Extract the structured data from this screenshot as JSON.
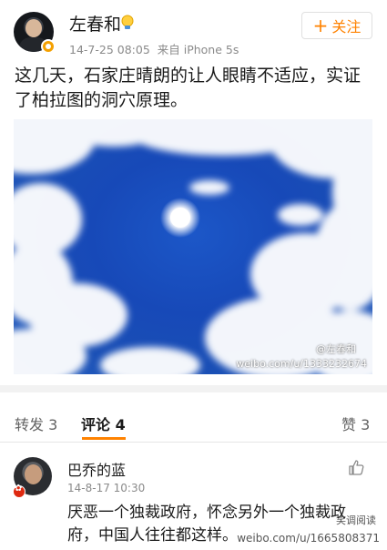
{
  "post": {
    "author": "左春和",
    "date": "14-7-25 08:05",
    "source": "来自 iPhone 5s",
    "follow_label": "关注",
    "text": "这几天，石家庄晴朗的让人眼睛不适应，实证了柏拉图的洞穴原理。",
    "photo_watermark_handle": "@左春和",
    "photo_watermark_url": "weibo.com/u/1333232674"
  },
  "tabs": {
    "repost": "转发 3",
    "comment": "评论 4",
    "like": "赞 3"
  },
  "comment": {
    "name": "巴乔的蓝",
    "time": "14-8-17 10:30",
    "text": "厌恶一个独裁政府，怀念另外一个独裁政府，中国人往往都这样。"
  },
  "page_watermark": {
    "account": "笑调阅读",
    "url": "weibo.com/u/1665808371"
  },
  "colors": {
    "accent": "#ff8200",
    "sky": "#1a4fb5"
  }
}
